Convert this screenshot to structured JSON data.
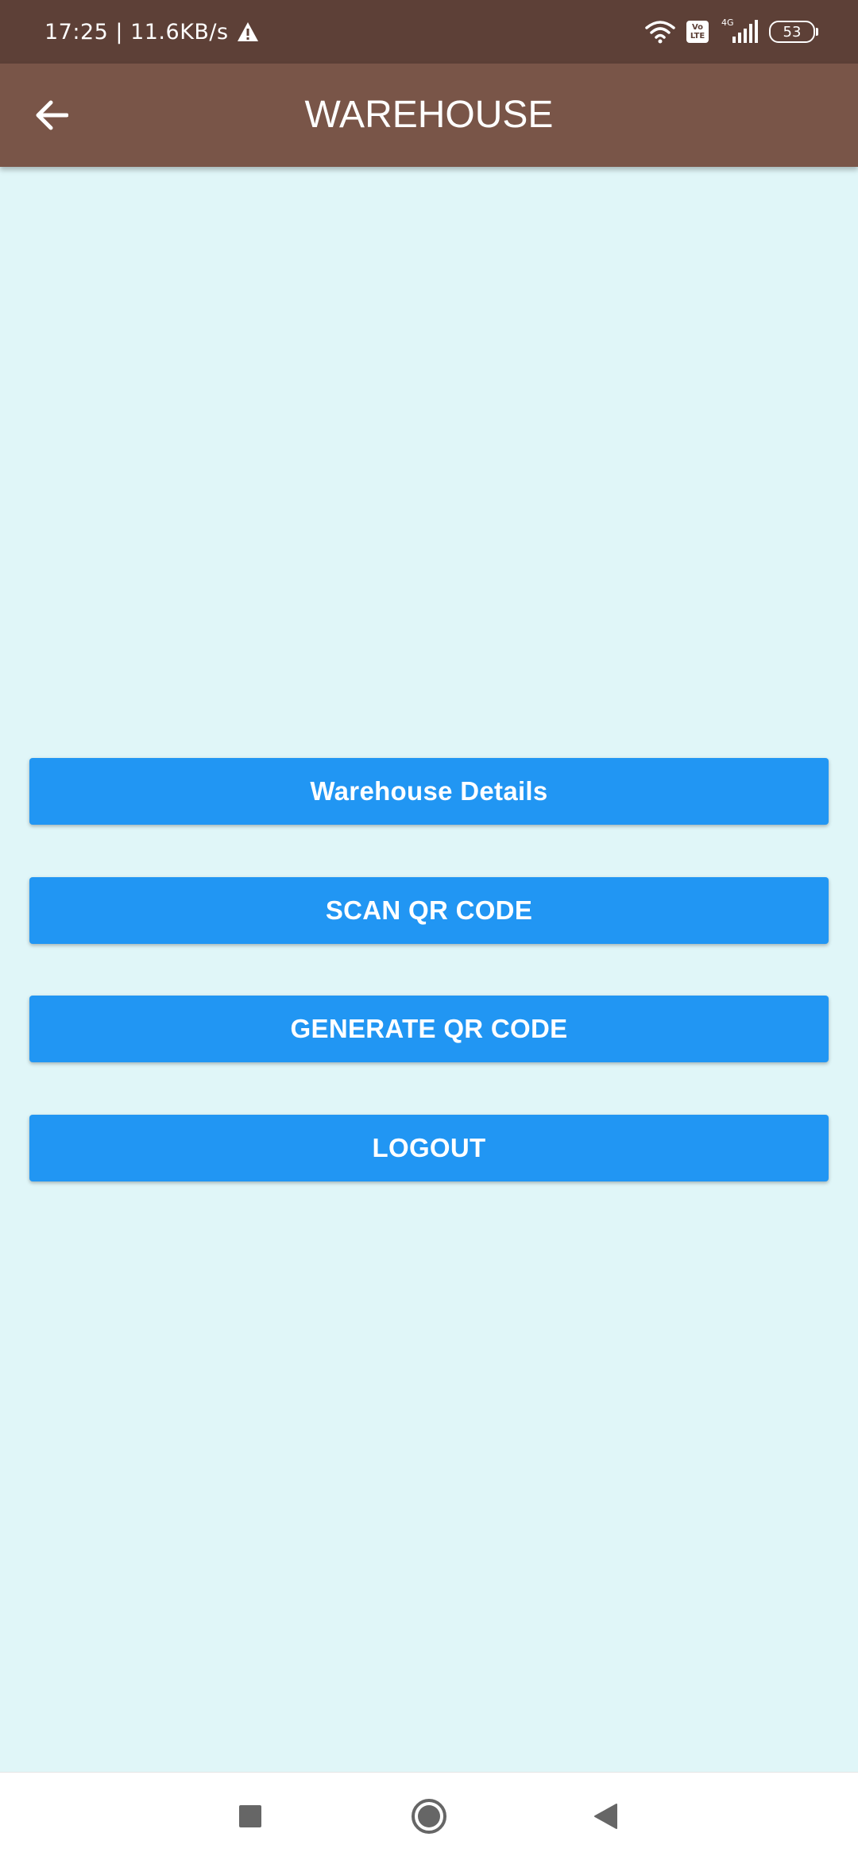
{
  "status_bar": {
    "time_speed": "17:25 | 11.6KB/s",
    "network_type": "4G",
    "volte_top": "Vo",
    "volte_bottom": "LTE",
    "battery_level": "53",
    "icons": [
      "warning-icon",
      "wifi-icon",
      "volte-icon",
      "signal-icon",
      "battery-icon"
    ]
  },
  "app_bar": {
    "title": "WAREHOUSE",
    "back_icon": "arrow-left-icon",
    "color": "#795548"
  },
  "menu": {
    "warehouse_details": "Warehouse Details",
    "scan_qr": "SCAN QR CODE",
    "generate_qr": "GENERATE QR CODE",
    "logout": "LOGOUT",
    "button_color": "#2196f3"
  },
  "nav_bar": {
    "icons": [
      "recents-square-icon",
      "home-circle-icon",
      "back-triangle-icon"
    ]
  },
  "colors": {
    "status_bar": "#5d4037",
    "background": "#e0f6f8"
  }
}
